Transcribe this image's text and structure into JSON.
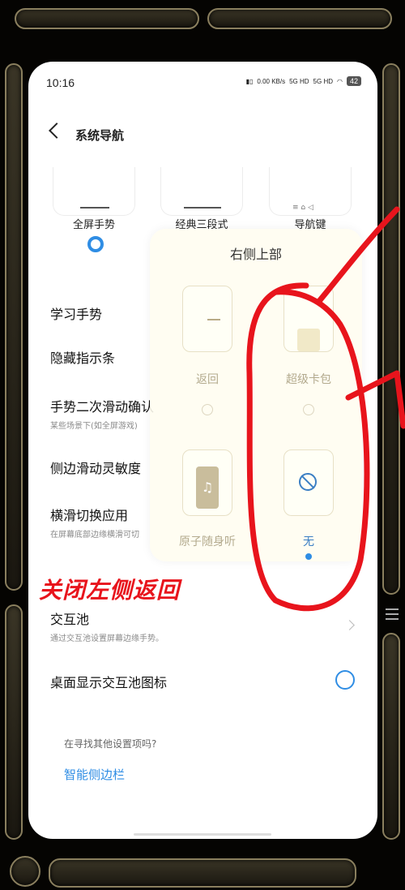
{
  "status": {
    "time": "10:16",
    "network_speed": "0.00 KB/s",
    "sim1": "5G HD",
    "sim2": "5G HD",
    "battery": "42"
  },
  "header": {
    "title": "系统导航"
  },
  "nav_styles": {
    "options": [
      "全屏手势",
      "经典三段式",
      "导航键"
    ],
    "selected": 0
  },
  "settings": [
    {
      "title": "学习手势",
      "subtitle": ""
    },
    {
      "title": "隐藏指示条",
      "subtitle": ""
    },
    {
      "title": "手势二次滑动确认",
      "subtitle": "某些场景下(如全屏游戏)"
    },
    {
      "title": "侧边滑动灵敏度",
      "subtitle": ""
    },
    {
      "title": "横滑切换应用",
      "subtitle": "在屏幕底部边缘横滑可切"
    },
    {
      "title": "交互池",
      "subtitle": "通过交互池设置屏幕边缘手势。"
    },
    {
      "title": "桌面显示交互池图标",
      "subtitle": ""
    }
  ],
  "overlay": {
    "title": "右侧上部",
    "options": [
      "返回",
      "超级卡包",
      "原子随身听",
      "无"
    ],
    "selected": 3
  },
  "footer": {
    "hint": "在寻找其他设置项吗?",
    "link": "智能侧边栏"
  },
  "annotation": {
    "caption": "关闭左侧返回",
    "color": "#e8141c"
  },
  "colors": {
    "accent": "#2f8de4",
    "frame": "#8a7f5e"
  }
}
